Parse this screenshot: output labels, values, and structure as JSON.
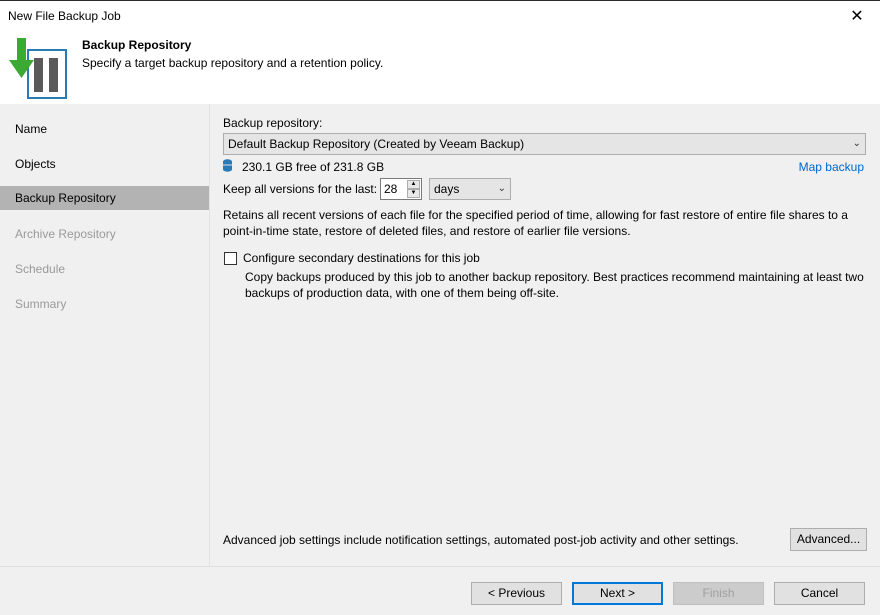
{
  "window": {
    "title": "New File Backup Job",
    "close_label": "✕"
  },
  "header": {
    "title": "Backup Repository",
    "subtitle": "Specify a target backup repository and a retention policy.",
    "icon": "backup-job-icon"
  },
  "sidebar": {
    "items": [
      {
        "label": "Name",
        "state": "normal"
      },
      {
        "label": "Objects",
        "state": "normal"
      },
      {
        "label": "Backup Repository",
        "state": "active"
      },
      {
        "label": "Archive Repository",
        "state": "disabled"
      },
      {
        "label": "Schedule",
        "state": "disabled"
      },
      {
        "label": "Summary",
        "state": "disabled"
      }
    ]
  },
  "main": {
    "repository_label": "Backup repository:",
    "repository_value": "Default Backup Repository (Created by Veeam Backup)",
    "free_space": "230.1 GB free of 231.8 GB",
    "map_backup": "Map backup",
    "keep_label": "Keep all versions for the last:",
    "keep_value": "28",
    "keep_unit": "days",
    "retention_desc": "Retains all recent versions of each file for the specified period of time, allowing for fast restore of entire file shares to a point-in-time state, restore of deleted files, and restore of earlier file versions.",
    "secondary_checkbox_label": "Configure secondary destinations for this job",
    "secondary_checked": false,
    "secondary_desc": "Copy backups produced by this job to another backup repository. Best practices recommend maintaining at least two backups of production data, with one of them being off-site.",
    "advanced_desc": "Advanced job settings include notification settings, automated post-job activity and other settings.",
    "advanced_button": "Advanced..."
  },
  "footer": {
    "previous": "< Previous",
    "next": "Next >",
    "finish": "Finish",
    "cancel": "Cancel"
  },
  "colors": {
    "link": "#0066cc",
    "active_step": "#b3b3b3",
    "primary_border": "#0078d7",
    "icon_green": "#3aaa35",
    "icon_blue": "#2a7ab8"
  }
}
